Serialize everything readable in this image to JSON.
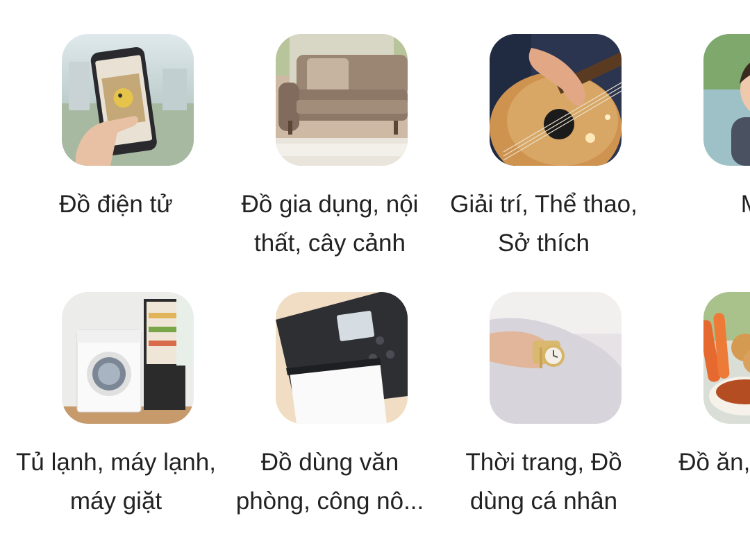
{
  "categories": [
    {
      "label": "Đồ điện tử",
      "icon": "smartphone-icon"
    },
    {
      "label": "Đồ gia dụng, nội thất, cây cảnh",
      "icon": "sofa-icon"
    },
    {
      "label": "Giải trí, Thể thao, Sở thích",
      "icon": "guitar-icon"
    },
    {
      "label": "Mẹ",
      "icon": "baby-icon"
    },
    {
      "label": "Tủ lạnh, máy lạnh, máy giặt",
      "icon": "appliance-icon"
    },
    {
      "label": "Đồ dùng văn phòng, công nô...",
      "icon": "printer-icon"
    },
    {
      "label": "Thời trang, Đồ dùng cá nhân",
      "icon": "watch-icon"
    },
    {
      "label": "Đồ ăn, phẩm v",
      "icon": "food-icon"
    }
  ]
}
